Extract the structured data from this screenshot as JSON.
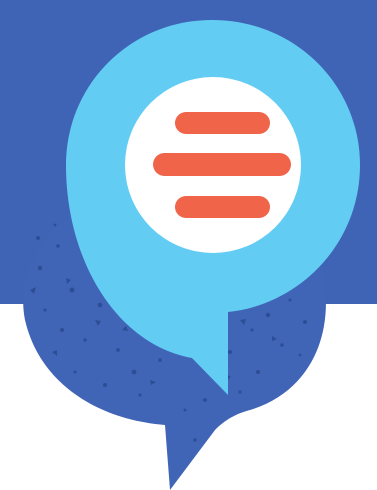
{
  "colors": {
    "background": "#ffffff",
    "blue_panel": "#3F63B5",
    "back_bubble": "#4064B6",
    "speckle": "#2D4E97",
    "front_bubble": "#63CCF3",
    "inner_circle": "#ffffff",
    "bars": "#F0644A"
  },
  "icon": "chat-bubble-menu-icon"
}
